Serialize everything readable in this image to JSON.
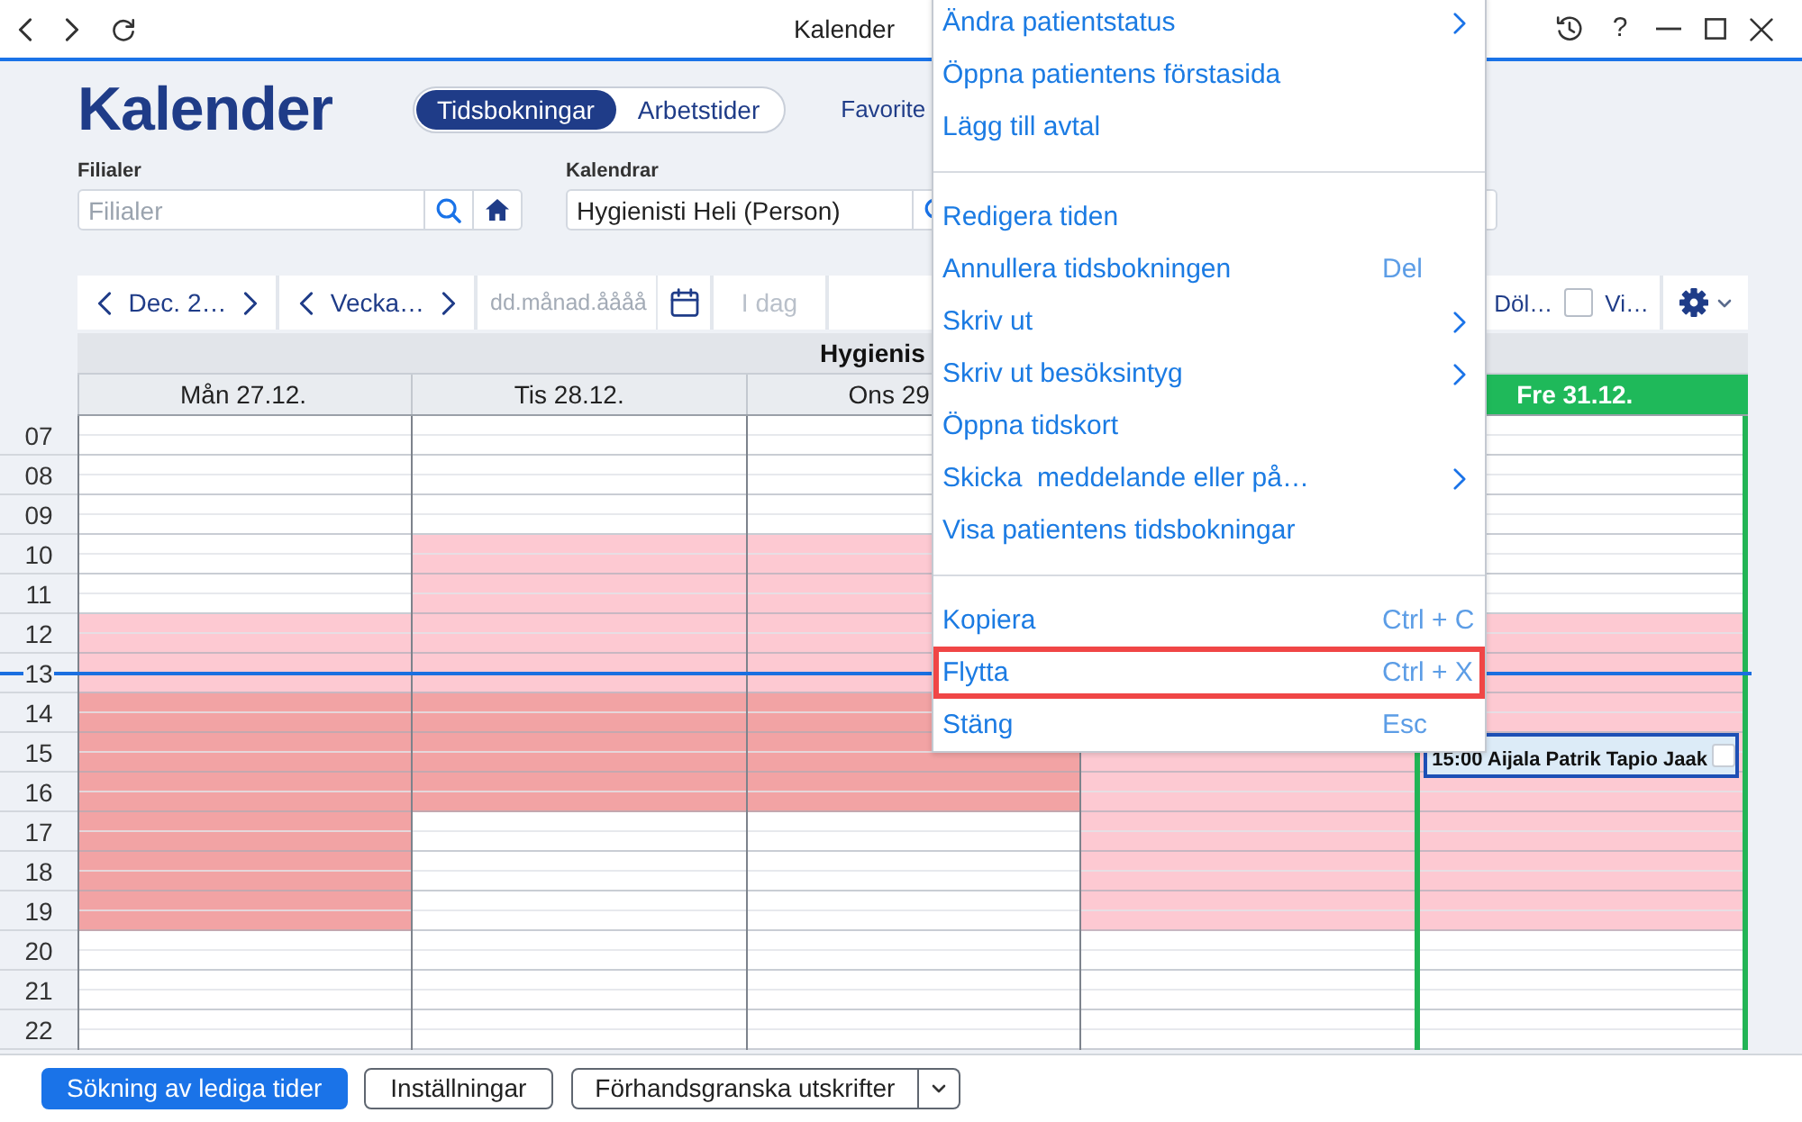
{
  "window": {
    "title": "Kalender",
    "help": "?"
  },
  "header": {
    "title": "Kalender",
    "view_tabs": [
      {
        "label": "Tidsbokningar",
        "selected": true
      },
      {
        "label": "Arbetstider",
        "selected": false
      }
    ],
    "favorites": "Favorite"
  },
  "filters": [
    {
      "label": "Filialer",
      "placeholder": "Filialer",
      "buttons": [
        {
          "kind": "search"
        },
        {
          "kind": "home"
        }
      ]
    },
    {
      "label": "Kalendrar",
      "value": "Hygienisti Heli (Person)",
      "buttons": [
        {
          "kind": "search"
        }
      ]
    }
  ],
  "toolbar": {
    "month": "Dec. 2…",
    "week": "Vecka…",
    "date_placeholder": "dd.månad.åååå",
    "today_button": {
      "label": "I dag",
      "disabled": true
    },
    "options": [
      {
        "kind": "text",
        "label": "Döl…"
      },
      {
        "kind": "checkbox",
        "label": "Vi…",
        "checked": false
      }
    ]
  },
  "calendar": {
    "resource": "Hygienis",
    "hours": [
      {
        "label": "07",
        "now": false
      },
      {
        "label": "08",
        "now": false
      },
      {
        "label": "09",
        "now": false
      },
      {
        "label": "10",
        "now": false
      },
      {
        "label": "11",
        "now": false
      },
      {
        "label": "12",
        "now": false
      },
      {
        "label": "13",
        "now": true
      },
      {
        "label": "14",
        "now": false
      },
      {
        "label": "15",
        "now": false
      },
      {
        "label": "16",
        "now": false
      },
      {
        "label": "17",
        "now": false
      },
      {
        "label": "18",
        "now": false
      },
      {
        "label": "19",
        "now": false
      },
      {
        "label": "20",
        "now": false
      },
      {
        "label": "21",
        "now": false
      },
      {
        "label": "22",
        "now": false
      }
    ],
    "days": [
      {
        "label": "Mån 27.12.",
        "today": false,
        "slots": [
          {
            "color": "#ffffff"
          },
          {
            "color": "#ffffff"
          },
          {
            "color": "#ffffff"
          },
          {
            "color": "#ffffff"
          },
          {
            "color": "#ffffff"
          },
          {
            "color": "#fdc9d2"
          },
          {
            "color": "#fdc9d2"
          },
          {
            "color": "#f2a3a4"
          },
          {
            "color": "#f2a3a4"
          },
          {
            "color": "#f2a3a4"
          },
          {
            "color": "#f2a3a4"
          },
          {
            "color": "#f2a3a4"
          },
          {
            "color": "#f2a3a4"
          },
          {
            "color": "#ffffff"
          },
          {
            "color": "#ffffff"
          },
          {
            "color": "#ffffff"
          }
        ]
      },
      {
        "label": "Tis 28.12.",
        "today": false,
        "slots": [
          {
            "color": "#ffffff"
          },
          {
            "color": "#ffffff"
          },
          {
            "color": "#ffffff"
          },
          {
            "color": "#fdc9d2"
          },
          {
            "color": "#fdc9d2"
          },
          {
            "color": "#fdc9d2"
          },
          {
            "color": "#fdc9d2"
          },
          {
            "color": "#f2a3a4"
          },
          {
            "color": "#f2a3a4"
          },
          {
            "color": "#f2a3a4"
          },
          {
            "color": "#ffffff"
          },
          {
            "color": "#ffffff"
          },
          {
            "color": "#ffffff"
          },
          {
            "color": "#ffffff"
          },
          {
            "color": "#ffffff"
          },
          {
            "color": "#ffffff"
          }
        ]
      },
      {
        "label": "Ons 29",
        "today": false,
        "slots": [
          {
            "color": "#ffffff"
          },
          {
            "color": "#ffffff"
          },
          {
            "color": "#ffffff"
          },
          {
            "color": "#fdc9d2"
          },
          {
            "color": "#fdc9d2"
          },
          {
            "color": "#fdc9d2"
          },
          {
            "color": "#fdc9d2"
          },
          {
            "color": "#f2a3a4"
          },
          {
            "color": "#f2a3a4"
          },
          {
            "color": "#f2a3a4"
          },
          {
            "color": "#ffffff"
          },
          {
            "color": "#ffffff"
          },
          {
            "color": "#ffffff"
          },
          {
            "color": "#ffffff"
          },
          {
            "color": "#ffffff"
          },
          {
            "color": "#ffffff"
          }
        ]
      },
      {
        "today": false,
        "slots": [
          {
            "color": "#fdc9d2"
          },
          {
            "color": "#fdc9d2"
          },
          {
            "color": "#fdc9d2"
          },
          {
            "color": "#fdc9d2"
          },
          {
            "color": "#fdc9d2"
          },
          {
            "color": "#ffffff"
          },
          {
            "color": "#ffffff"
          },
          {
            "color": "#ffffff"
          }
        ]
      },
      {
        "label": "Fre 31.12.",
        "today": true,
        "slots": [
          {
            "color": "#ffffff"
          },
          {
            "color": "#ffffff"
          },
          {
            "color": "#ffffff"
          },
          {
            "color": "#ffffff"
          },
          {
            "color": "#ffffff"
          },
          {
            "color": "#fdc9d2"
          },
          {
            "color": "#fdc9d2"
          },
          {
            "color": "#fdc9d2"
          },
          {
            "color": "#fdc9d2",
            "appointments": [
              {
                "text": "15:00 Aijala Patrik Tapio Jaak",
                "checked": false
              }
            ]
          },
          {
            "color": "#fdc9d2"
          },
          {
            "color": "#fdc9d2"
          },
          {
            "color": "#fdc9d2"
          },
          {
            "color": "#fdc9d2"
          },
          {
            "color": "#ffffff"
          },
          {
            "color": "#ffffff"
          },
          {
            "color": "#ffffff"
          }
        ]
      }
    ]
  },
  "context_menu": {
    "sections": [
      [
        {
          "label": "Ändra patientstatus",
          "submenu": true,
          "highlighted": false
        },
        {
          "label": "Öppna patientens förstasida",
          "submenu": false,
          "highlighted": false
        },
        {
          "label": "Lägg till avtal",
          "submenu": false,
          "highlighted": false
        }
      ],
      [
        {
          "label": "Redigera tiden",
          "submenu": false,
          "highlighted": false
        },
        {
          "label": "Annullera tidsbokningen",
          "shortcut": "Del",
          "submenu": false,
          "highlighted": false
        },
        {
          "label": "Skriv ut",
          "submenu": true,
          "highlighted": false
        },
        {
          "label": "Skriv ut besöksintyg",
          "submenu": true,
          "highlighted": false
        },
        {
          "label": "Öppna tidskort",
          "submenu": false,
          "highlighted": false
        },
        {
          "label": "Skicka  meddelande eller på…",
          "submenu": true,
          "highlighted": false
        },
        {
          "label": "Visa patientens tidsbokningar",
          "submenu": false,
          "highlighted": false
        }
      ],
      [
        {
          "label": "Kopiera",
          "shortcut": "Ctrl + C",
          "submenu": false,
          "highlighted": false
        },
        {
          "label": "Flytta",
          "shortcut": "Ctrl + X",
          "submenu": false,
          "highlighted": true
        },
        {
          "label": "Stäng",
          "shortcut": "Esc",
          "submenu": false,
          "highlighted": false
        }
      ]
    ]
  },
  "bottom_bar": {
    "buttons": [
      {
        "kind": "primary",
        "label": "Sökning av lediga tider"
      },
      {
        "kind": "secondary",
        "label": "Inställningar"
      },
      {
        "kind": "split",
        "label": "Förhandsgranska utskrifter"
      }
    ]
  }
}
